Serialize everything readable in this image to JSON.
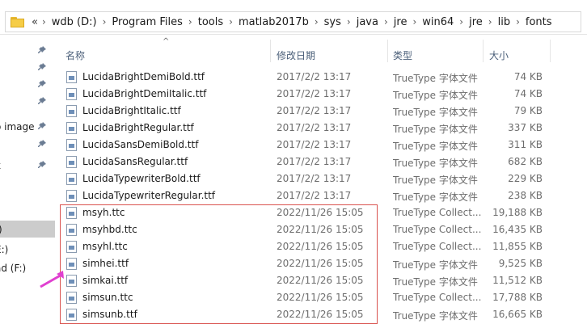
{
  "address": {
    "overflow": "«",
    "crumbs": [
      "wdb (D:)",
      "Program Files",
      "tools",
      "matlab2017b",
      "sys",
      "java",
      "jre",
      "win64",
      "jre",
      "lib",
      "fonts"
    ]
  },
  "nav": {
    "items": [
      {
        "label": "",
        "pinned": true
      },
      {
        "label": "",
        "pinned": true
      },
      {
        "label": "",
        "pinned": true
      },
      {
        "label": "",
        "pinned": true
      },
      {
        "label": "o image",
        "pinned": true
      },
      {
        "label": "",
        "pinned": true
      },
      {
        "label": "k",
        "pinned": true
      },
      {
        "label": "",
        "pinned": false
      },
      {
        "label": ")",
        "pinned": false
      },
      {
        "label": ":)",
        "pinned": false,
        "selected": true
      },
      {
        "label": "E:)",
        "pinned": false
      },
      {
        "label": "ad (F:)",
        "pinned": false
      },
      {
        "label": "",
        "pinned": false
      }
    ]
  },
  "columns": {
    "name": "名称",
    "date": "修改日期",
    "type": "类型",
    "size": "大小",
    "sort_indicator": "^"
  },
  "files": [
    {
      "name": "LucidaBrightDemiBold.ttf",
      "date": "2017/2/2 13:17",
      "type": "TrueType 字体文件",
      "size": "74 KB"
    },
    {
      "name": "LucidaBrightDemiItalic.ttf",
      "date": "2017/2/2 13:17",
      "type": "TrueType 字体文件",
      "size": "74 KB"
    },
    {
      "name": "LucidaBrightItalic.ttf",
      "date": "2017/2/2 13:17",
      "type": "TrueType 字体文件",
      "size": "79 KB"
    },
    {
      "name": "LucidaBrightRegular.ttf",
      "date": "2017/2/2 13:17",
      "type": "TrueType 字体文件",
      "size": "337 KB"
    },
    {
      "name": "LucidaSansDemiBold.ttf",
      "date": "2017/2/2 13:17",
      "type": "TrueType 字体文件",
      "size": "311 KB"
    },
    {
      "name": "LucidaSansRegular.ttf",
      "date": "2017/2/2 13:17",
      "type": "TrueType 字体文件",
      "size": "682 KB"
    },
    {
      "name": "LucidaTypewriterBold.ttf",
      "date": "2017/2/2 13:17",
      "type": "TrueType 字体文件",
      "size": "229 KB"
    },
    {
      "name": "LucidaTypewriterRegular.ttf",
      "date": "2017/2/2 13:17",
      "type": "TrueType 字体文件",
      "size": "238 KB"
    },
    {
      "name": "msyh.ttc",
      "date": "2022/11/26 15:05",
      "type": "TrueType Collect...",
      "size": "19,188 KB"
    },
    {
      "name": "msyhbd.ttc",
      "date": "2022/11/26 15:05",
      "type": "TrueType Collect...",
      "size": "16,435 KB"
    },
    {
      "name": "msyhl.ttc",
      "date": "2022/11/26 15:05",
      "type": "TrueType Collect...",
      "size": "11,855 KB"
    },
    {
      "name": "simhei.ttf",
      "date": "2022/11/26 15:05",
      "type": "TrueType 字体文件",
      "size": "9,525 KB"
    },
    {
      "name": "simkai.ttf",
      "date": "2022/11/26 15:05",
      "type": "TrueType 字体文件",
      "size": "11,512 KB"
    },
    {
      "name": "simsun.ttc",
      "date": "2022/11/26 15:05",
      "type": "TrueType Collect...",
      "size": "17,788 KB"
    },
    {
      "name": "simsunb.ttf",
      "date": "2022/11/26 15:05",
      "type": "TrueType 字体文件",
      "size": "16,665 KB"
    }
  ],
  "colors": {
    "highlight_box": "#d9534f",
    "annotation_arrow": "#e040d0",
    "header_text": "#4c607a",
    "selected_nav": "#cccccc",
    "folder": "#f6cd47"
  },
  "icons": {
    "folder": "folder-icon",
    "pin": "pin-icon",
    "font_file": "font-file-icon"
  }
}
